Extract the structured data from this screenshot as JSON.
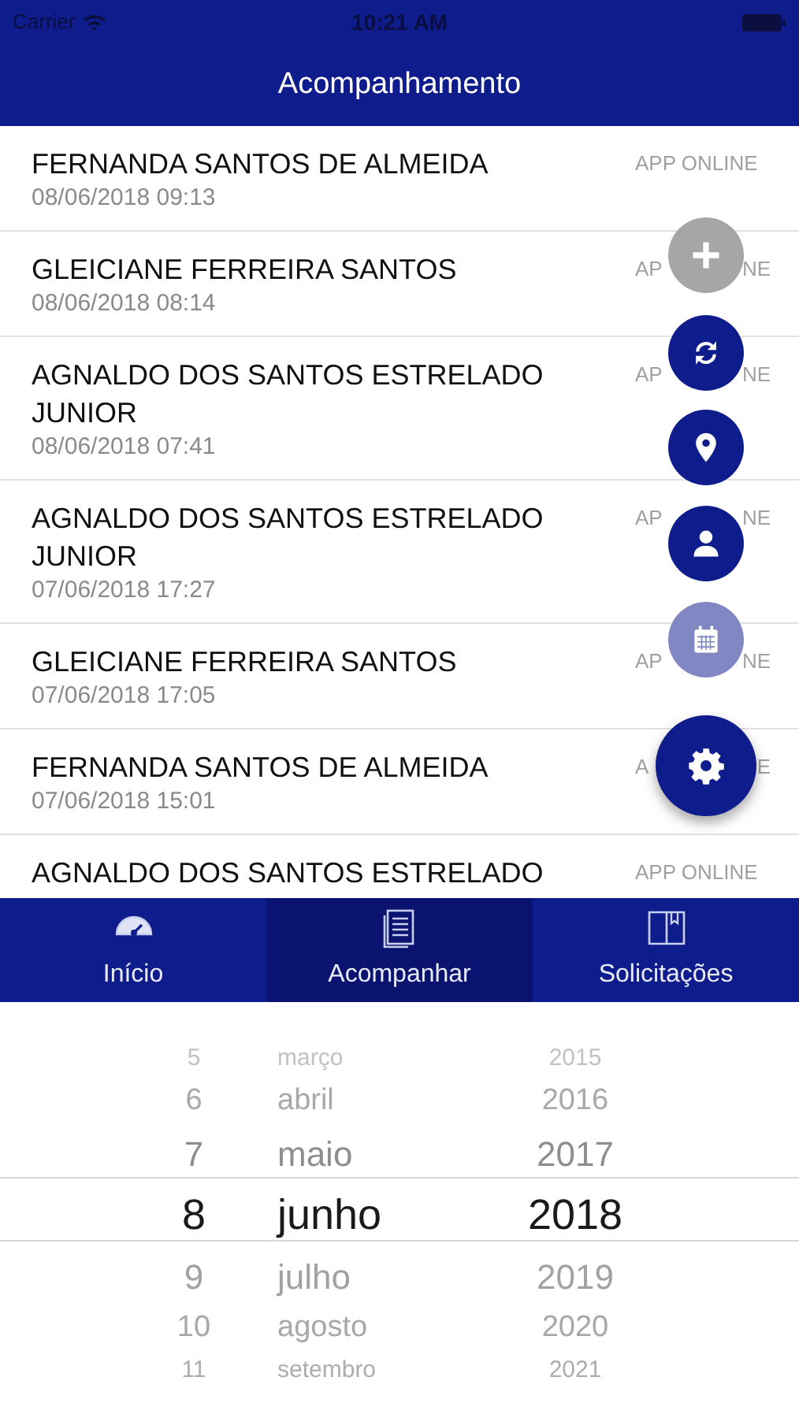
{
  "status_bar": {
    "carrier": "Carrier",
    "time": "10:21 AM"
  },
  "nav_bar": {
    "title": "Acompanhamento"
  },
  "rows": [
    {
      "name": "FERNANDA SANTOS DE ALMEIDA",
      "date": "08/06/2018 09:13",
      "status": [
        "APP ONLINE"
      ]
    },
    {
      "name": "GLEICIANE FERREIRA SANTOS",
      "date": "08/06/2018 08:14",
      "status": [
        "AP",
        "NE"
      ]
    },
    {
      "name": "AGNALDO DOS SANTOS ESTRELADO JUNIOR",
      "date": "08/06/2018 07:41",
      "status": [
        "AP",
        "NE"
      ]
    },
    {
      "name": "AGNALDO DOS SANTOS ESTRELADO JUNIOR",
      "date": "07/06/2018 17:27",
      "status": [
        "AP",
        "NE"
      ]
    },
    {
      "name": "GLEICIANE FERREIRA SANTOS",
      "date": "07/06/2018 17:05",
      "status": [
        "AP",
        "NE"
      ]
    },
    {
      "name": "FERNANDA SANTOS DE ALMEIDA",
      "date": "07/06/2018 15:01",
      "status": [
        "A",
        "E"
      ]
    },
    {
      "name": "AGNALDO DOS SANTOS ESTRELADO",
      "status": [
        "APP ONLINE"
      ]
    }
  ],
  "fab_actions": [
    {
      "kind": "add",
      "disabled": true
    },
    {
      "kind": "sync",
      "disabled": false
    },
    {
      "kind": "location",
      "disabled": false
    },
    {
      "kind": "user",
      "disabled": false
    },
    {
      "kind": "calendar",
      "disabled": true
    },
    {
      "kind": "settings",
      "disabled": false
    }
  ],
  "tab_bar": [
    {
      "kind": "gauge",
      "label": "Início",
      "selected": false
    },
    {
      "kind": "list",
      "label": "Acompanhar",
      "selected": true
    },
    {
      "kind": "book",
      "label": "Solicitações",
      "selected": false
    }
  ],
  "date_picker": [
    {
      "day": "5",
      "month": "março",
      "year": "2015",
      "selected": false
    },
    {
      "day": "6",
      "month": "abril",
      "year": "2016",
      "selected": false
    },
    {
      "day": "7",
      "month": "maio",
      "year": "2017",
      "selected": false
    },
    {
      "day": "8",
      "month": "junho",
      "year": "2018",
      "selected": true
    },
    {
      "day": "9",
      "month": "julho",
      "year": "2019",
      "selected": false
    },
    {
      "day": "10",
      "month": "agosto",
      "year": "2020",
      "selected": false
    },
    {
      "day": "11",
      "month": "setembro",
      "year": "2021",
      "selected": false
    }
  ]
}
